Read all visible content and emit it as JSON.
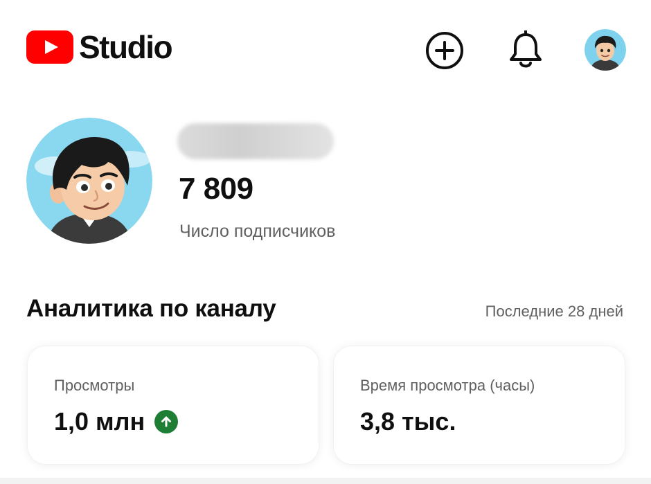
{
  "header": {
    "logo_text": "Studio",
    "create_icon": "plus-circle-icon",
    "notifications_icon": "bell-icon",
    "avatar_icon": "account-avatar"
  },
  "channel": {
    "name": "",
    "subscriber_count": "7 809",
    "subscriber_label": "Число подписчиков"
  },
  "analytics": {
    "title": "Аналитика по каналу",
    "period": "Последние 28 дней",
    "cards": [
      {
        "label": "Просмотры",
        "value": "1,0 млн",
        "trend": "up",
        "trend_icon": "arrow-up-icon"
      },
      {
        "label": "Время просмотра (часы)",
        "value": "3,8 тыс."
      }
    ]
  },
  "colors": {
    "brand_red": "#ff0000",
    "trend_green": "#1e7e34",
    "text_primary": "#0f0f0f",
    "text_secondary": "#606060"
  }
}
